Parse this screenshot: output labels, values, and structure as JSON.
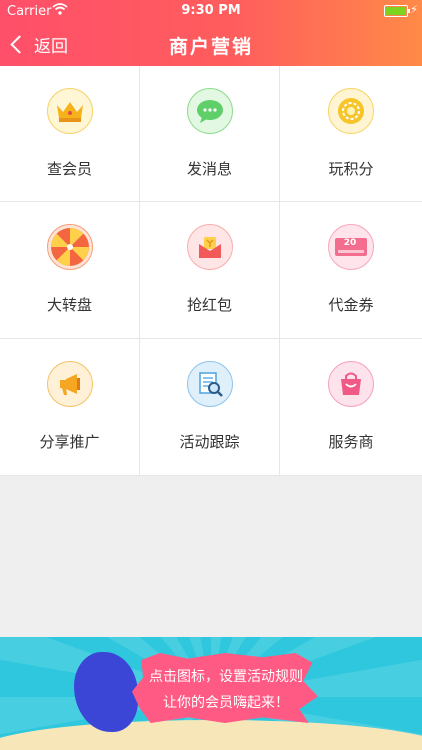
{
  "status": {
    "carrier": "Carrier",
    "time": "9:30 PM"
  },
  "nav": {
    "back_label": "返回",
    "title": "商户营销"
  },
  "grid": [
    {
      "label": "查会员",
      "icon": "crown-icon",
      "color": "#f5b21b",
      "bg": "#fff6d6"
    },
    {
      "label": "发消息",
      "icon": "chat-bubble-icon",
      "color": "#5fcf6a",
      "bg": "#e3f8e2"
    },
    {
      "label": "玩积分",
      "icon": "coin-icon",
      "color": "#f7c52a",
      "bg": "#fff5d2"
    },
    {
      "label": "大转盘",
      "icon": "prize-wheel-icon",
      "color": "#f3663f",
      "bg": "#ffe3d6"
    },
    {
      "label": "抢红包",
      "icon": "red-envelope-icon",
      "color": "#f25a5a",
      "bg": "#ffe5e5"
    },
    {
      "label": "代金券",
      "icon": "coupon-icon",
      "color": "#f36d8e",
      "bg": "#ffe4ec",
      "text": "20"
    },
    {
      "label": "分享推广",
      "icon": "megaphone-icon",
      "color": "#f5a623",
      "bg": "#fff1d8"
    },
    {
      "label": "活动跟踪",
      "icon": "document-search-icon",
      "color": "#4aa3e0",
      "bg": "#e0f0fb"
    },
    {
      "label": "服务商",
      "icon": "shopping-bag-icon",
      "color": "#f05a87",
      "bg": "#ffe3ec"
    }
  ],
  "banner": {
    "line1": "点击图标，设置活动规则",
    "line2": "让你的会员嗨起来！"
  }
}
